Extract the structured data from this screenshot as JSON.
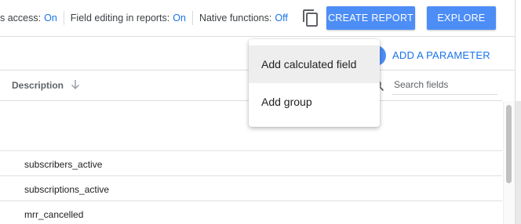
{
  "toolbar": {
    "settings": [
      {
        "label": "s access:",
        "value": "On"
      },
      {
        "label": "Field editing in reports:",
        "value": "On"
      },
      {
        "label": "Native functions:",
        "value": "Off"
      }
    ],
    "copy_icon": "copy-icon",
    "create_report_label": "CREATE REPORT",
    "explore_label": "EXPLORE"
  },
  "parameter": {
    "add_label": "ADD A PARAMETER"
  },
  "table": {
    "header": {
      "description": "Description",
      "sort_icon": "arrow-down-icon"
    },
    "search": {
      "placeholder": "Search fields",
      "icon": "search-icon"
    },
    "rows": [
      {
        "description": ""
      },
      {
        "description": "subscribers_active"
      },
      {
        "description": "subscriptions_active"
      },
      {
        "description": "mrr_cancelled"
      }
    ]
  },
  "menu": {
    "items": [
      {
        "label": "Add calculated field",
        "highlighted": true
      },
      {
        "label": "Add group",
        "highlighted": false
      }
    ]
  },
  "colors": {
    "accent": "#4d8df6",
    "link": "#1a73e8"
  }
}
